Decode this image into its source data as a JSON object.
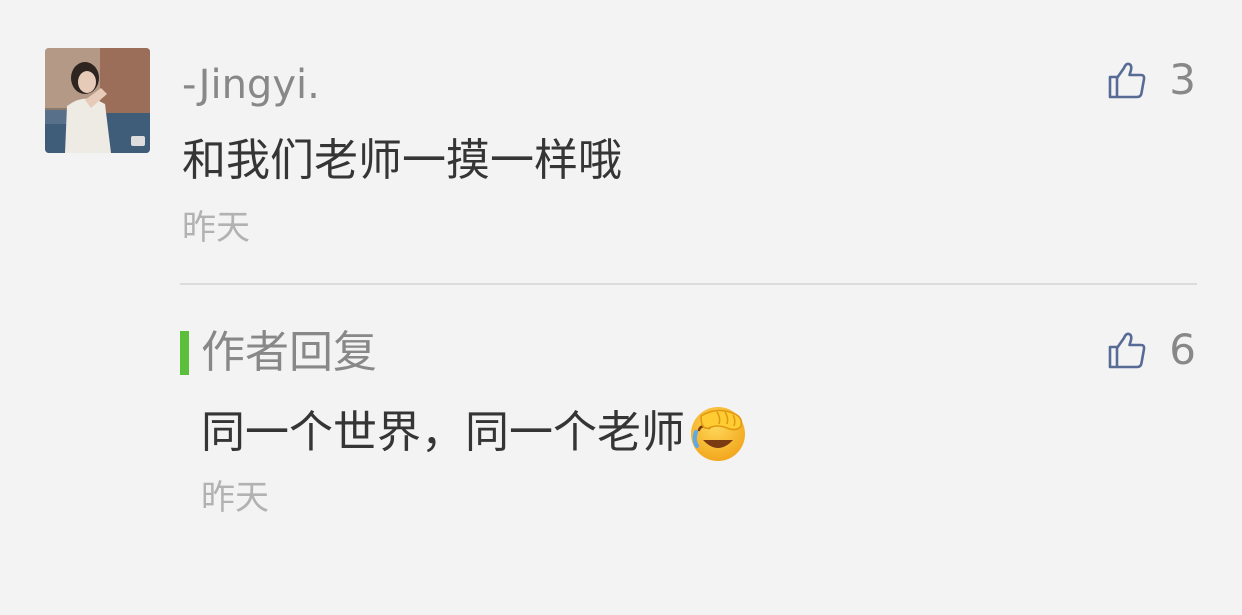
{
  "comment": {
    "username": "-Jingyi.",
    "text": "和我们老师一摸一样哦",
    "time": "昨天",
    "likes": "3"
  },
  "reply": {
    "label": "作者回复",
    "text": "同一个世界，同一个老师",
    "emoji": "face-palm-laughing-emoji",
    "time": "昨天",
    "likes": "6"
  },
  "colors": {
    "accent_bar": "#5cbf3c",
    "thumb_icon": "#576b95",
    "background": "#f3f3f3"
  }
}
